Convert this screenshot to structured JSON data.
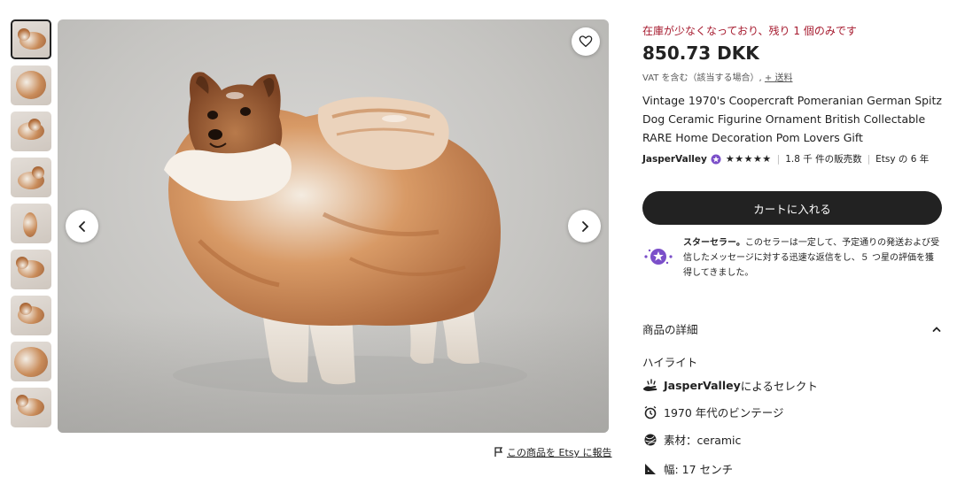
{
  "gallery": {
    "thumbnail_count": 10,
    "active_index": 0,
    "report_link": "この商品を Etsy に報告"
  },
  "product": {
    "stock_notice": "在庫が少なくなっており、残り 1 個のみです",
    "price": "850.73 DKK",
    "vat_note": "VAT を含む（該当する場合）,",
    "shipping_link": "+ 送料",
    "title": "Vintage 1970's Coopercraft Pomeranian German Spitz Dog Ceramic Figurine Ornament British Collectable RARE Home Decoration Pom Lovers Gift"
  },
  "seller": {
    "name": "JasperValley",
    "stars": "★★★★★",
    "sales": "1.8 千 件の販売数",
    "tenure": "Etsy の 6 年"
  },
  "cart": {
    "button_label": "カートに入れる"
  },
  "star_seller": {
    "title": "スターセラー。",
    "body": "このセラーは一定して、予定通りの発送および受信したメッセージに対する迅速な返信をし、５ つ星の評価を獲得してきました。"
  },
  "details": {
    "header": "商品の詳細",
    "highlights_title": "ハイライト",
    "items": [
      {
        "icon": "hand-icon",
        "bold": "JasperValley",
        "text": " によるセレクト"
      },
      {
        "icon": "clock-icon",
        "bold": "",
        "text": "1970 年代のビンテージ"
      },
      {
        "icon": "yarn-icon",
        "bold": "",
        "text": "素材：ceramic"
      },
      {
        "icon": "ruler-icon",
        "bold": "",
        "text": "幅: 17 センチ"
      }
    ]
  },
  "colors": {
    "stock_red": "#a61a2e",
    "button_dark": "#222222",
    "star_seller_purple": "#7b4fc9"
  }
}
